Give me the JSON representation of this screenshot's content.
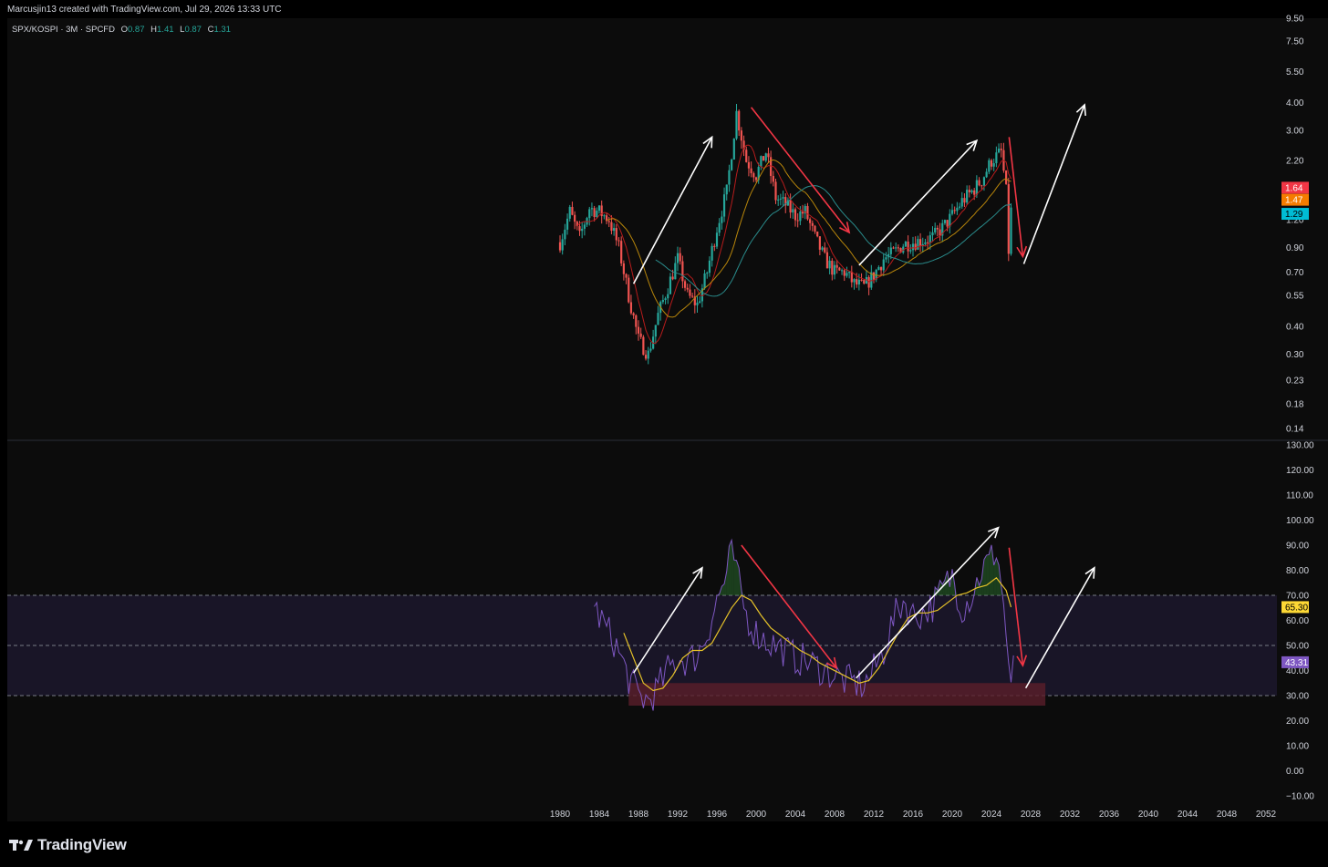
{
  "attribution": "Marcusjin13 created with TradingView.com, Jul 29, 2026 13:33 UTC",
  "legend": {
    "symbol": "SPX/KOSPI · 3M · SPCFD",
    "open_label": "O",
    "open": "0.87",
    "high_label": "H",
    "high": "1.41",
    "low_label": "L",
    "low": "0.87",
    "close_label": "C",
    "close": "1.31"
  },
  "brand": {
    "name": "TradingView"
  },
  "colors": {
    "up": "#26a69a",
    "down": "#ef5350",
    "ma_red": "#b71c1c",
    "ma_orange": "#b8860b",
    "ma_teal": "#2a8c8c",
    "rsi": "#7e57c2",
    "rsi_ma": "#e6c229",
    "band": "#1d1830",
    "support_zone": "#5a1e2b",
    "arrow_up": "#ffffff",
    "arrow_down": "#f23645"
  },
  "chart_data": [
    {
      "type": "candlestick",
      "symbol": "SPX/KOSPI",
      "scale": "log",
      "ylim": [
        0.14,
        9.5
      ],
      "y_ticks": [
        "9.50",
        "7.50",
        "5.50",
        "4.00",
        "3.00",
        "2.20",
        "1.20",
        "0.90",
        "0.70",
        "0.55",
        "0.40",
        "0.30",
        "0.23",
        "0.18",
        "0.14"
      ],
      "x_ticks": [
        "1980",
        "1984",
        "1988",
        "1992",
        "1996",
        "2000",
        "2004",
        "2008",
        "2012",
        "2016",
        "2020",
        "2024",
        "2028",
        "2032",
        "2036",
        "2040",
        "2044",
        "2048",
        "2052"
      ],
      "anchors": [
        [
          1980,
          0.95
        ],
        [
          1981,
          1.3
        ],
        [
          1982,
          1.0
        ],
        [
          1983,
          1.35
        ],
        [
          1984,
          1.3
        ],
        [
          1985,
          1.2
        ],
        [
          1986,
          0.9
        ],
        [
          1987,
          0.55
        ],
        [
          1988,
          0.35
        ],
        [
          1989,
          0.3
        ],
        [
          1990,
          0.45
        ],
        [
          1991,
          0.6
        ],
        [
          1992,
          0.8
        ],
        [
          1993,
          0.55
        ],
        [
          1994,
          0.5
        ],
        [
          1995,
          0.7
        ],
        [
          1996,
          1.1
        ],
        [
          1997,
          1.6
        ],
        [
          1998,
          3.6
        ],
        [
          1999,
          2.2
        ],
        [
          2000,
          1.9
        ],
        [
          2001,
          2.4
        ],
        [
          2002,
          1.5
        ],
        [
          2003,
          1.4
        ],
        [
          2004,
          1.25
        ],
        [
          2005,
          1.3
        ],
        [
          2006,
          1.0
        ],
        [
          2007,
          0.8
        ],
        [
          2008,
          0.7
        ],
        [
          2009,
          0.7
        ],
        [
          2010,
          0.62
        ],
        [
          2011,
          0.6
        ],
        [
          2012,
          0.68
        ],
        [
          2013,
          0.8
        ],
        [
          2014,
          0.85
        ],
        [
          2015,
          0.93
        ],
        [
          2016,
          0.95
        ],
        [
          2017,
          0.97
        ],
        [
          2018,
          1.0
        ],
        [
          2019,
          1.1
        ],
        [
          2020,
          1.25
        ],
        [
          2021,
          1.45
        ],
        [
          2022,
          1.6
        ],
        [
          2023,
          1.8
        ],
        [
          2024,
          2.2
        ],
        [
          2025,
          2.4
        ],
        [
          2025.5,
          1.6
        ],
        [
          2025.75,
          0.87
        ],
        [
          2026,
          1.31
        ]
      ],
      "moving_averages": [
        {
          "color_key": "ma_red",
          "last": "1.64"
        },
        {
          "color_key": "ma_orange",
          "last": "1.47"
        },
        {
          "color_key": "ma_teal",
          "last": "1.29"
        }
      ],
      "badges": [
        {
          "value": "1.64",
          "bg": "#f23645",
          "fg": "#ffffff"
        },
        {
          "value": "1.47",
          "bg": "#f57c00",
          "fg": "#ffffff"
        },
        {
          "value": "1.29",
          "bg": "#00bcd4",
          "fg": "#000000"
        }
      ],
      "arrows": [
        {
          "from": [
            1987.5,
            0.62
          ],
          "to": [
            1995.5,
            2.8
          ],
          "color": "arrow_up"
        },
        {
          "from": [
            1999.5,
            3.8
          ],
          "to": [
            2009.5,
            1.05
          ],
          "color": "arrow_down"
        },
        {
          "from": [
            2010.5,
            0.75
          ],
          "to": [
            2022.5,
            2.7
          ],
          "color": "arrow_up"
        },
        {
          "from": [
            2025.8,
            2.8
          ],
          "to": [
            2027.2,
            0.82
          ],
          "color": "arrow_down"
        },
        {
          "from": [
            2027.3,
            0.76
          ],
          "to": [
            2033.5,
            3.9
          ],
          "color": "arrow_up"
        }
      ]
    },
    {
      "type": "line",
      "indicator": "RSI",
      "ylim": [
        -10,
        130
      ],
      "y_ticks": [
        "130.00",
        "120.00",
        "110.00",
        "100.00",
        "90.00",
        "80.00",
        "70.00",
        "60.00",
        "50.00",
        "40.00",
        "30.00",
        "20.00",
        "10.00",
        "0.00",
        "−10.00"
      ],
      "levels": [
        70,
        50,
        30
      ],
      "band": [
        30,
        70
      ],
      "rsi_anchors": [
        [
          1983.5,
          65
        ],
        [
          1984.5,
          58
        ],
        [
          1985.5,
          52
        ],
        [
          1986.5,
          42
        ],
        [
          1987,
          37
        ],
        [
          1988,
          30
        ],
        [
          1989,
          28
        ],
        [
          1990,
          33
        ],
        [
          1991,
          40
        ],
        [
          1992,
          45
        ],
        [
          1993,
          44
        ],
        [
          1994,
          46
        ],
        [
          1995,
          55
        ],
        [
          1996,
          68
        ],
        [
          1997,
          78
        ],
        [
          1997.5,
          90
        ],
        [
          1998.2,
          75
        ],
        [
          1999,
          62
        ],
        [
          2000,
          55
        ],
        [
          2001,
          52
        ],
        [
          2002,
          50
        ],
        [
          2003,
          48
        ],
        [
          2004,
          45
        ],
        [
          2005,
          44
        ],
        [
          2006,
          42
        ],
        [
          2007,
          40
        ],
        [
          2008,
          38
        ],
        [
          2009,
          36
        ],
        [
          2010,
          35
        ],
        [
          2011,
          34
        ],
        [
          2012,
          40
        ],
        [
          2013,
          48
        ],
        [
          2014,
          60
        ],
        [
          2015,
          68
        ],
        [
          2016,
          62
        ],
        [
          2017,
          63
        ],
        [
          2018,
          66
        ],
        [
          2019,
          72
        ],
        [
          2020,
          78
        ],
        [
          2021,
          65
        ],
        [
          2022,
          70
        ],
        [
          2023,
          80
        ],
        [
          2024,
          85
        ],
        [
          2024.5,
          88
        ],
        [
          2025,
          75
        ],
        [
          2025.5,
          55
        ],
        [
          2026,
          30
        ],
        [
          2026.3,
          43.31
        ]
      ],
      "ma_anchors": [
        [
          1986.5,
          55
        ],
        [
          1987.5,
          45
        ],
        [
          1988.5,
          35
        ],
        [
          1989.5,
          32
        ],
        [
          1990.5,
          33
        ],
        [
          1991.5,
          38
        ],
        [
          1992.5,
          45
        ],
        [
          1993.5,
          48
        ],
        [
          1994.5,
          48
        ],
        [
          1995.5,
          51
        ],
        [
          1996.5,
          58
        ],
        [
          1997.5,
          65
        ],
        [
          1998.5,
          70
        ],
        [
          1999.5,
          68
        ],
        [
          2000.5,
          62
        ],
        [
          2001.5,
          57
        ],
        [
          2002.5,
          54
        ],
        [
          2003.5,
          51
        ],
        [
          2004.5,
          48
        ],
        [
          2005.5,
          46
        ],
        [
          2006.5,
          43
        ],
        [
          2007.5,
          41
        ],
        [
          2008.5,
          39
        ],
        [
          2009.5,
          37
        ],
        [
          2010.5,
          35
        ],
        [
          2011.5,
          36
        ],
        [
          2012.5,
          41
        ],
        [
          2013.5,
          48
        ],
        [
          2014.5,
          55
        ],
        [
          2015.5,
          61
        ],
        [
          2016.5,
          63
        ],
        [
          2017.5,
          63
        ],
        [
          2018.5,
          64
        ],
        [
          2019.5,
          67
        ],
        [
          2020.5,
          70
        ],
        [
          2021.5,
          71
        ],
        [
          2022.5,
          73
        ],
        [
          2023.5,
          74
        ],
        [
          2024.5,
          77
        ],
        [
          2025.5,
          72
        ],
        [
          2026,
          65.3
        ]
      ],
      "support_zone": {
        "x": [
          1987,
          2029.5
        ],
        "y": [
          26,
          35
        ]
      },
      "badges": [
        {
          "value": "65.30",
          "bg": "#fdd835",
          "fg": "#000000"
        },
        {
          "value": "43.31",
          "bg": "#7e57c2",
          "fg": "#ffffff"
        }
      ],
      "arrows": [
        {
          "from": [
            1987.5,
            39
          ],
          "to": [
            1994.5,
            81
          ],
          "color": "arrow_up"
        },
        {
          "from": [
            1998.5,
            90
          ],
          "to": [
            2008.2,
            41
          ],
          "color": "arrow_down"
        },
        {
          "from": [
            2010.2,
            37
          ],
          "to": [
            2024.7,
            97
          ],
          "color": "arrow_up"
        },
        {
          "from": [
            2025.8,
            89
          ],
          "to": [
            2027.2,
            42
          ],
          "color": "arrow_down"
        },
        {
          "from": [
            2027.5,
            33
          ],
          "to": [
            2034.5,
            81
          ],
          "color": "arrow_up"
        }
      ]
    }
  ]
}
